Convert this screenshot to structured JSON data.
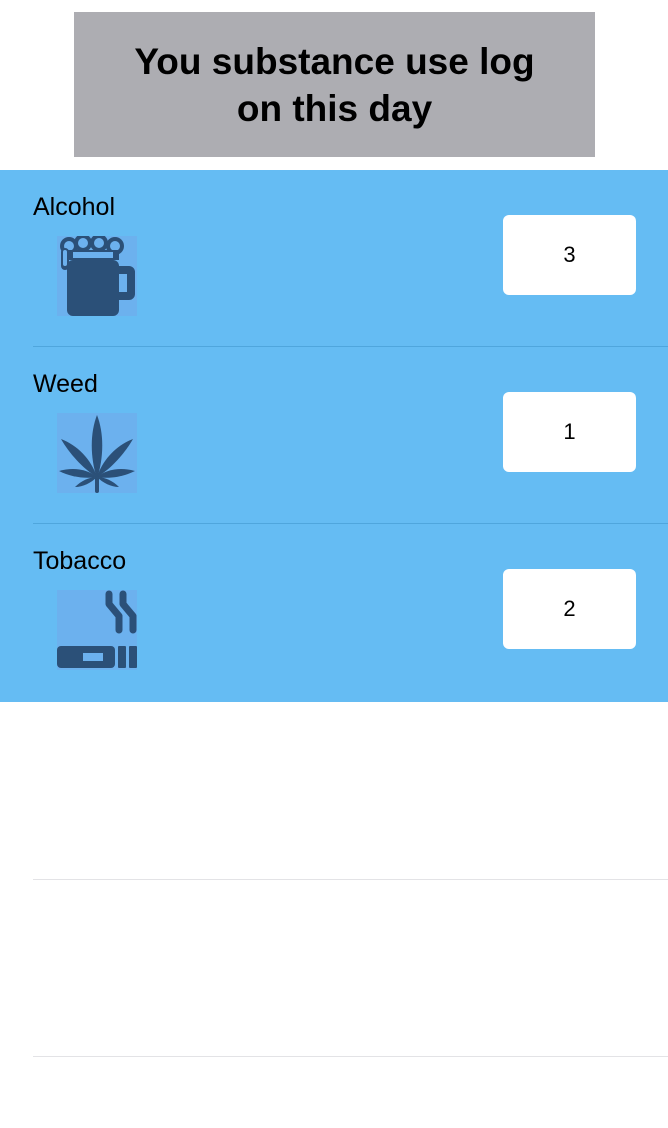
{
  "header": {
    "title": "You substance use log on this day"
  },
  "log": {
    "items": [
      {
        "label": "Alcohol",
        "icon": "beer-mug-icon",
        "count": "3"
      },
      {
        "label": "Weed",
        "icon": "cannabis-leaf-icon",
        "count": "1"
      },
      {
        "label": "Tobacco",
        "icon": "cigarette-smoking-icon",
        "count": "2"
      }
    ]
  },
  "colors": {
    "header_bg": "#adadb2",
    "row_bg": "#65bcf3",
    "icon_bg": "#6cb1ee",
    "icon_fg": "#2b5078",
    "field_bg": "#ffffff"
  }
}
